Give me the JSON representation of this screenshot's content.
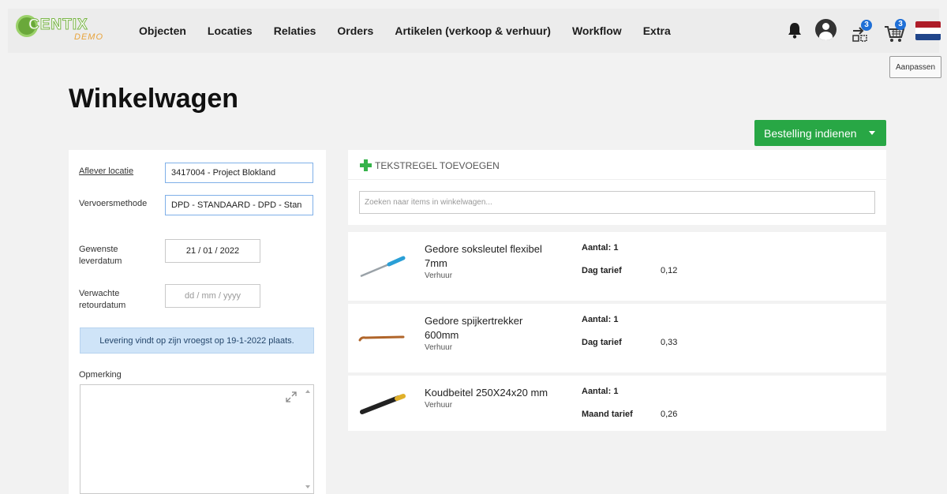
{
  "brand": {
    "logo_text": "CENTIX",
    "logo_sub": "DEMO"
  },
  "nav": [
    "Objecten",
    "Locaties",
    "Relaties",
    "Orders",
    "Artikelen (verkoop & verhuur)",
    "Workflow",
    "Extra"
  ],
  "header_icons": {
    "notifications": "bell-icon",
    "user": "user-avatar-icon",
    "compare": {
      "icon": "compare-icon",
      "badge": "3"
    },
    "cart": {
      "icon": "shopping-cart-icon",
      "badge": "3"
    },
    "language": "dutch-flag-icon"
  },
  "colors": {
    "primary_button": "#28a745",
    "badge": "#1f6fd6",
    "info_bg": "#cfe4f8",
    "add_icon": "#35b34a"
  },
  "customize_label": "Aanpassen",
  "page_title": "Winkelwagen",
  "submit": {
    "label": "Bestelling indienen"
  },
  "form": {
    "delivery_location": {
      "label": "Aflever locatie",
      "value": "3417004 - Project Blokland"
    },
    "shipping_method": {
      "label": "Vervoersmethode",
      "value": "DPD - STANDAARD - DPD - Stan"
    },
    "desired_date": {
      "label": "Gewenste leverdatum",
      "value": "21  /  01  /  2022"
    },
    "return_date": {
      "label": "Verwachte retourdatum",
      "placeholder": "dd  /  mm  /  yyyy"
    },
    "info": "Levering vindt op zijn vroegst op 19-1-2022 plaats.",
    "remark": {
      "label": "Opmerking",
      "value": ""
    }
  },
  "cart": {
    "add_text_line": "TEKSTREGEL TOEVOEGEN",
    "search_placeholder": "Zoeken naar items in winkelwagen...",
    "items": [
      {
        "name": "Gedore soksleutel flexibel 7mm",
        "type": "Verhuur",
        "qty": "Aantal: 1",
        "rate_label": "Dag tarief",
        "rate_value": "0,12"
      },
      {
        "name": "Gedore spijkertrekker 600mm",
        "type": "Verhuur",
        "qty": "Aantal: 1",
        "rate_label": "Dag tarief",
        "rate_value": "0,33"
      },
      {
        "name": "Koudbeitel 250X24x20 mm",
        "type": "Verhuur",
        "qty": "Aantal: 1",
        "rate_label": "Maand tarief",
        "rate_value": "0,26"
      }
    ]
  }
}
